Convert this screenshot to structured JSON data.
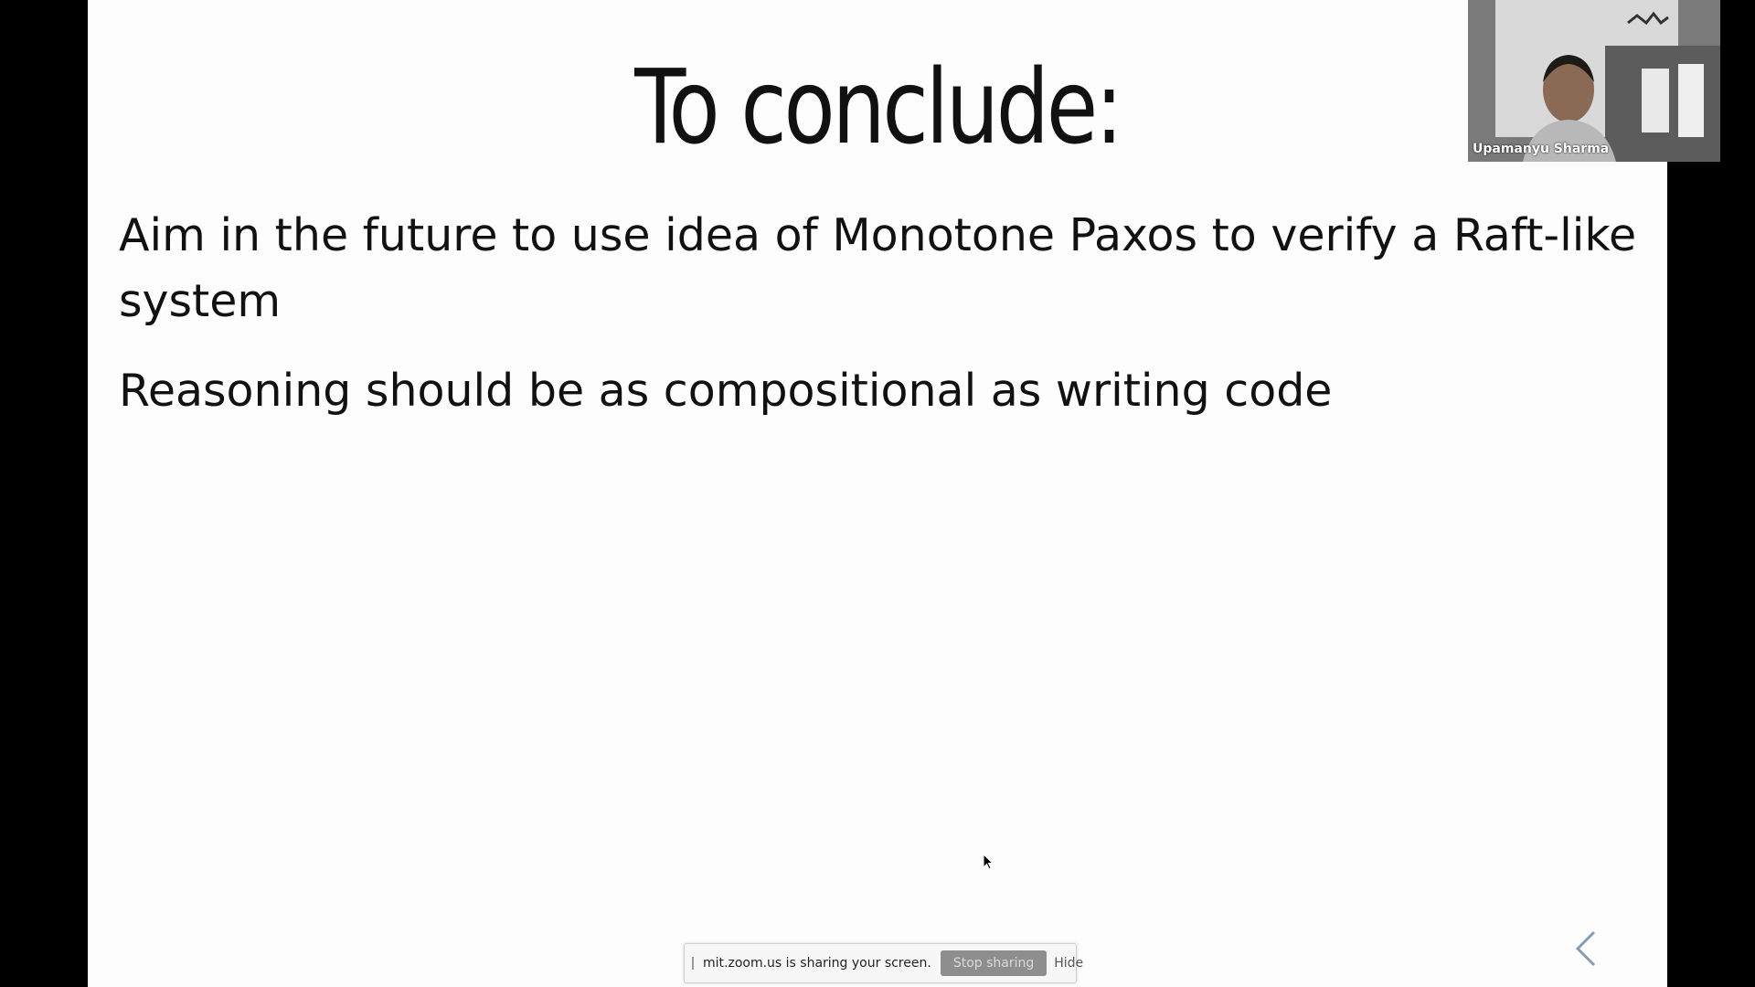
{
  "slide": {
    "title": "To conclude:",
    "bullets": [
      "Aim in the future to use idea of Monotone Paxos to verify a Raft-like system",
      "Reasoning should be as compositional as writing code"
    ],
    "nav": {
      "prev_icon": "chevron-left-icon"
    }
  },
  "share_bar": {
    "message": "mit.zoom.us is sharing your screen.",
    "stop_label": "Stop sharing",
    "hide_label": "Hide",
    "handle_icon": "drag-handle-icon"
  },
  "video": {
    "participant_name": "Upamanyu Sharma"
  },
  "colors": {
    "background": "#000000",
    "slide": "#fdfdfd",
    "text": "#111111",
    "stop_button": "#8e8e8e"
  }
}
